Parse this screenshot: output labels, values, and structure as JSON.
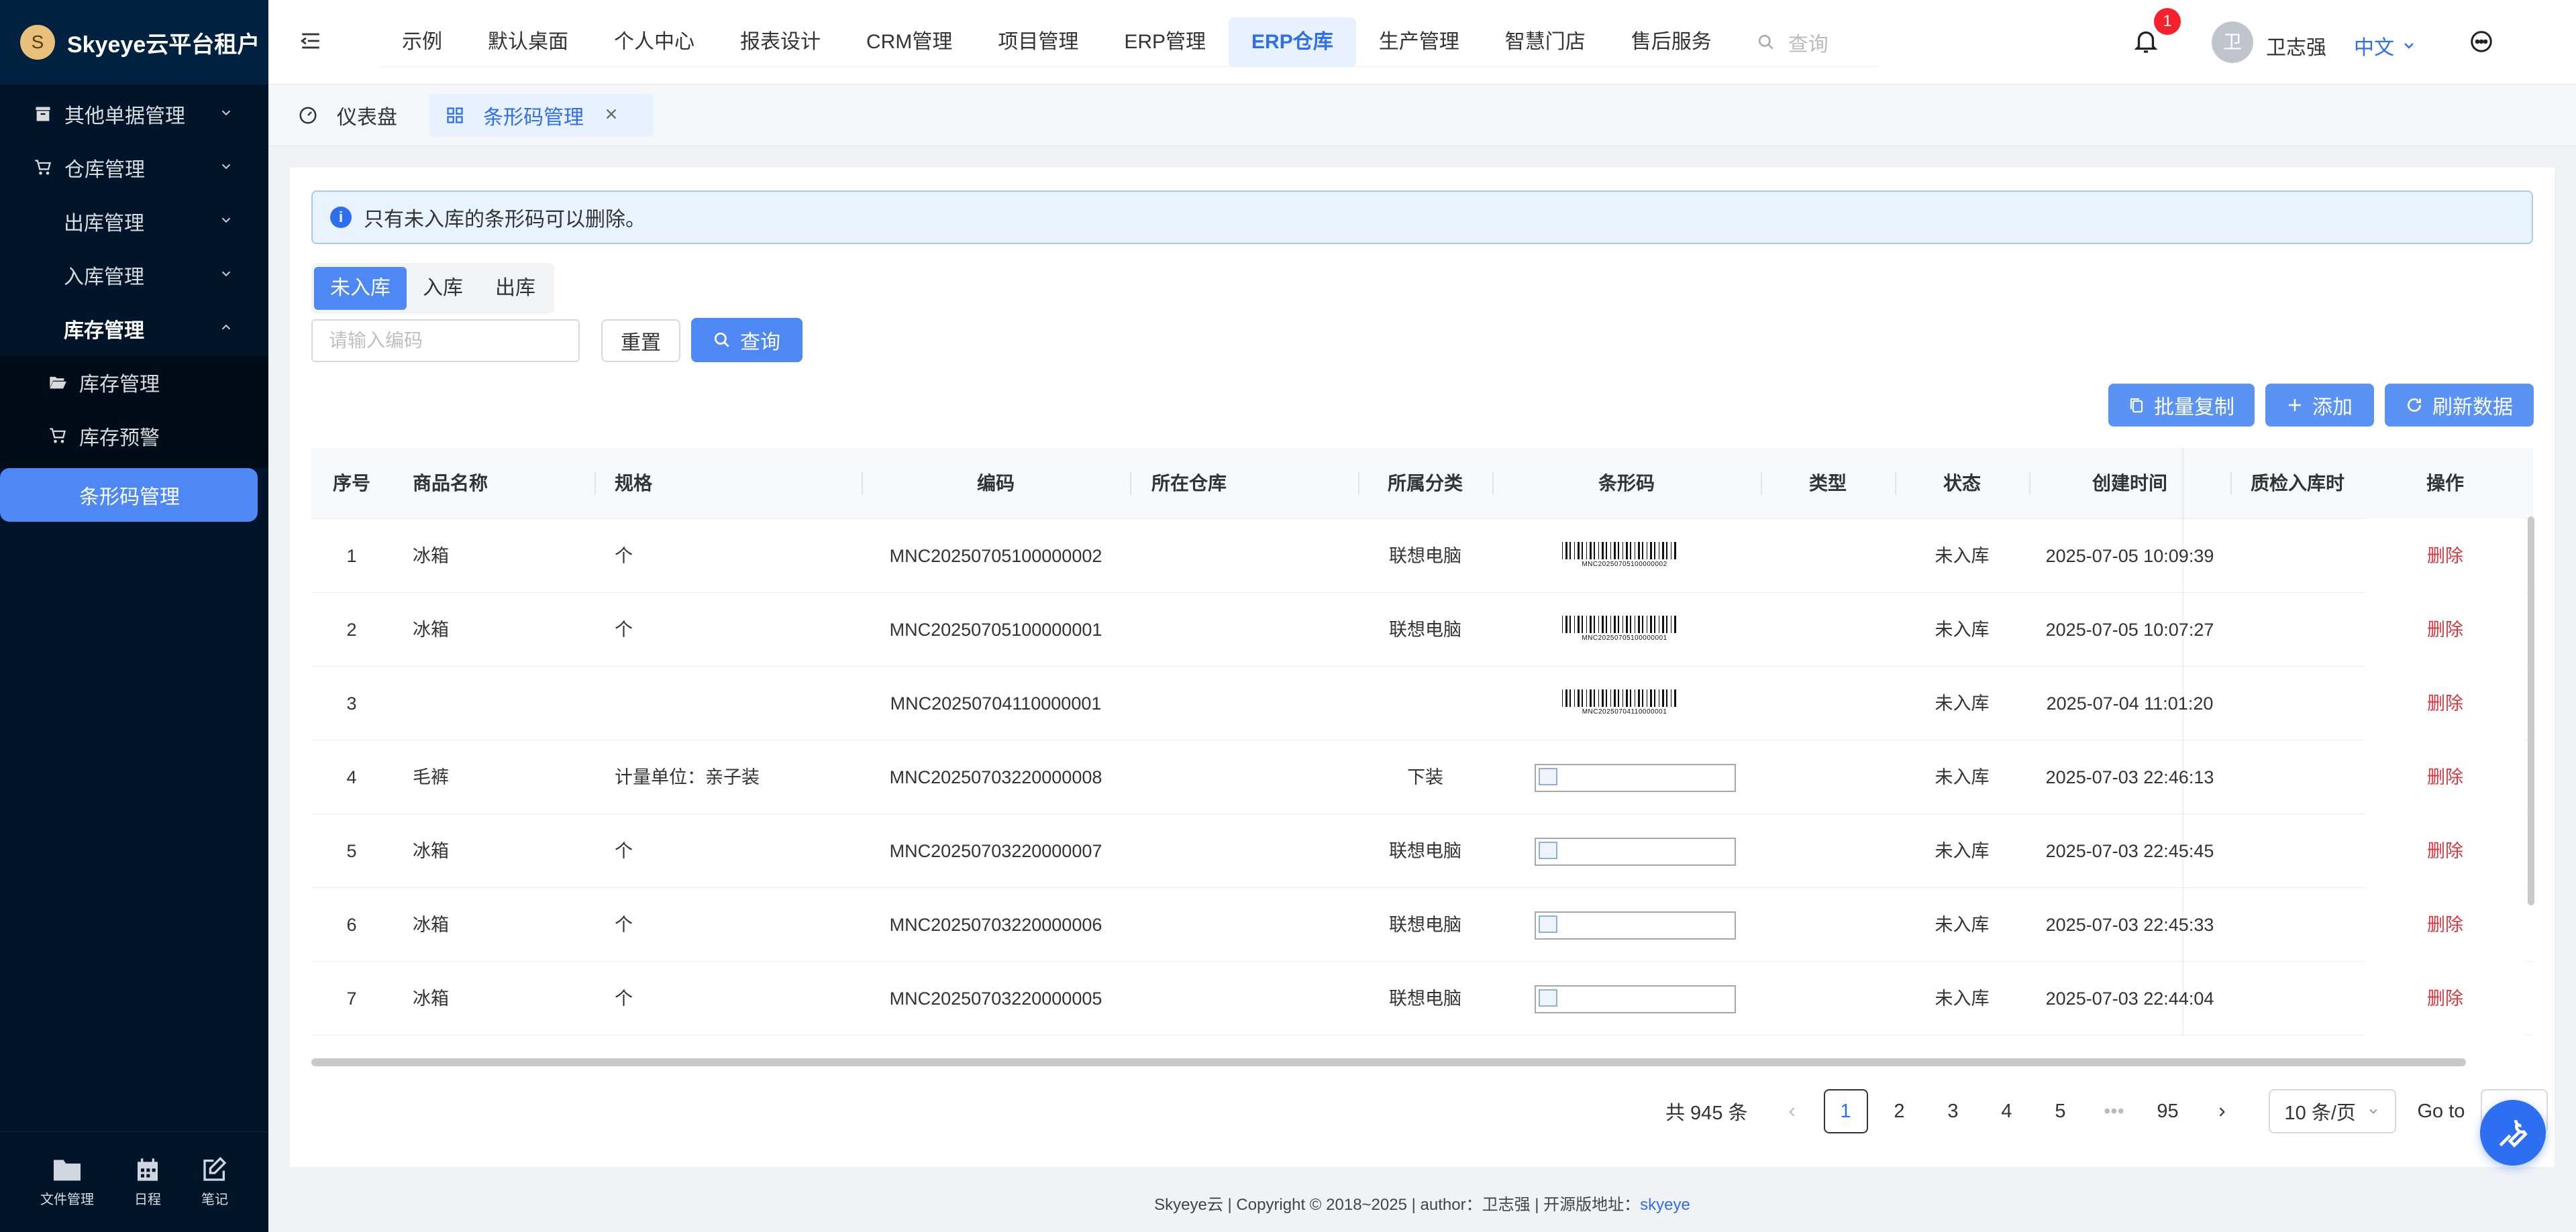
{
  "app": {
    "title": "Skyeye云平台租户",
    "logo_initial": "S"
  },
  "sidebar": {
    "items": [
      {
        "label": "其他单据管理"
      },
      {
        "label": "仓库管理"
      },
      {
        "label": "出库管理"
      },
      {
        "label": "入库管理"
      },
      {
        "label": "库存管理"
      },
      {
        "label": "库存管理"
      },
      {
        "label": "库存预警"
      },
      {
        "label": "条形码管理"
      }
    ],
    "bottom": [
      {
        "label": "文件管理",
        "icon": "folder-icon"
      },
      {
        "label": "日程",
        "icon": "calendar-icon"
      },
      {
        "label": "笔记",
        "icon": "note-icon"
      }
    ]
  },
  "header": {
    "nav": [
      "示例",
      "默认桌面",
      "个人中心",
      "报表设计",
      "CRM管理",
      "项目管理",
      "ERP管理",
      "ERP仓库",
      "生产管理",
      "智慧门店",
      "售后服务"
    ],
    "active_nav": "ERP仓库",
    "search_placeholder": "查询",
    "notification_count": "1",
    "user_initial": "卫",
    "user_name": "卫志强",
    "language": "中文"
  },
  "tabs": [
    {
      "label": "仪表盘"
    },
    {
      "label": "条形码管理"
    }
  ],
  "alert": {
    "text": "只有未入库的条形码可以删除。"
  },
  "filters": {
    "segments": [
      "未入库",
      "入库",
      "出库"
    ],
    "active_segment": "未入库",
    "code_placeholder": "请输入编码",
    "code_value": "",
    "reset_label": "重置",
    "query_label": "查询"
  },
  "actions": {
    "batch_copy": "批量复制",
    "add": "添加",
    "refresh": "刷新数据"
  },
  "table": {
    "headers": [
      "序号",
      "商品名称",
      "规格",
      "编码",
      "所在仓库",
      "所属分类",
      "条形码",
      "类型",
      "状态",
      "创建时间",
      "质检入库时",
      "操作"
    ],
    "rows": [
      {
        "no": "1",
        "name": "冰箱",
        "spec": "个",
        "code": "MNC20250705100000002",
        "warehouse": "",
        "category": "联想电脑",
        "barcode_text": "MNC20250705100000002",
        "type": "",
        "status": "未入库",
        "created": "2025-07-05 10:09:39",
        "qc_time": "",
        "action": "删除"
      },
      {
        "no": "2",
        "name": "冰箱",
        "spec": "个",
        "code": "MNC20250705100000001",
        "warehouse": "",
        "category": "联想电脑",
        "barcode_text": "MNC20250705100000001",
        "type": "",
        "status": "未入库",
        "created": "2025-07-05 10:07:27",
        "qc_time": "",
        "action": "删除"
      },
      {
        "no": "3",
        "name": "",
        "spec": "",
        "code": "MNC20250704110000001",
        "warehouse": "",
        "category": "",
        "barcode_text": "MNC20250704110000001",
        "type": "",
        "status": "未入库",
        "created": "2025-07-04 11:01:20",
        "qc_time": "",
        "action": "删除"
      },
      {
        "no": "4",
        "name": "毛裤",
        "spec": "计量单位：亲子装",
        "code": "MNC20250703220000008",
        "warehouse": "",
        "category": "下装",
        "barcode_text": "",
        "type": "",
        "status": "未入库",
        "created": "2025-07-03 22:46:13",
        "qc_time": "",
        "action": "删除"
      },
      {
        "no": "5",
        "name": "冰箱",
        "spec": "个",
        "code": "MNC20250703220000007",
        "warehouse": "",
        "category": "联想电脑",
        "barcode_text": "",
        "type": "",
        "status": "未入库",
        "created": "2025-07-03 22:45:45",
        "qc_time": "",
        "action": "删除"
      },
      {
        "no": "6",
        "name": "冰箱",
        "spec": "个",
        "code": "MNC20250703220000006",
        "warehouse": "",
        "category": "联想电脑",
        "barcode_text": "",
        "type": "",
        "status": "未入库",
        "created": "2025-07-03 22:45:33",
        "qc_time": "",
        "action": "删除"
      },
      {
        "no": "7",
        "name": "冰箱",
        "spec": "个",
        "code": "MNC20250703220000005",
        "warehouse": "",
        "category": "联想电脑",
        "barcode_text": "",
        "type": "",
        "status": "未入库",
        "created": "2025-07-03 22:44:04",
        "qc_time": "",
        "action": "删除"
      }
    ]
  },
  "pagination": {
    "total": "共 945 条",
    "pages": [
      "1",
      "2",
      "3",
      "4",
      "5"
    ],
    "ellipsis": "•••",
    "last_page": "95",
    "current": "1",
    "page_size": "10 条/页",
    "goto_label": "Go to",
    "goto_value": ""
  },
  "footer": {
    "text": "Skyeye云 | Copyright © 2018~2025 | author：卫志强 | 开源版地址：",
    "link": "skyeye"
  },
  "colors": {
    "primary": "#4e88f5",
    "sidebar_bg": "#001529",
    "danger": "#d9363e"
  }
}
